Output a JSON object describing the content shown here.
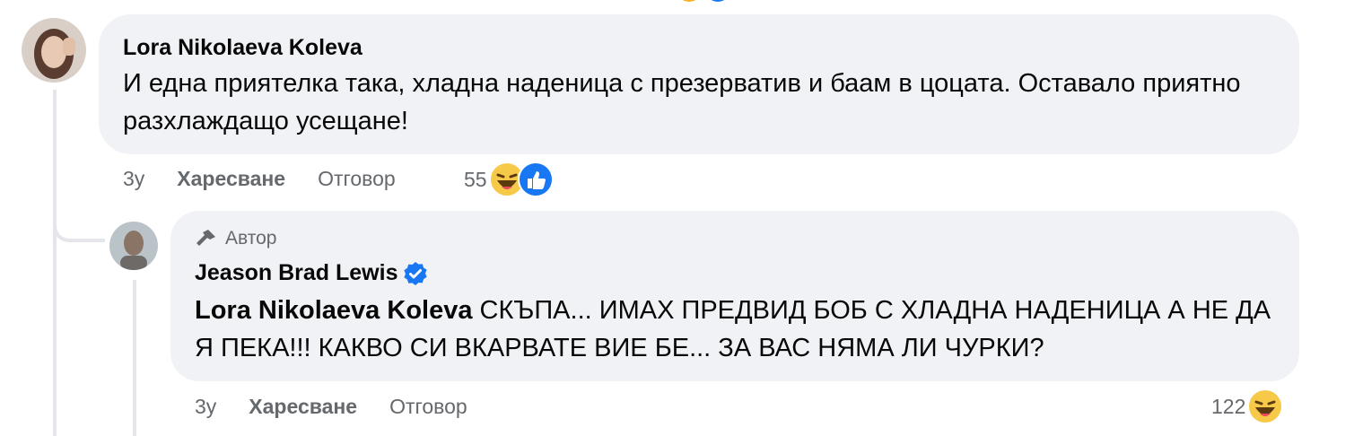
{
  "top_comment": {
    "author": "Lora Nikolaeva Koleva",
    "text": "И една приятелка така, хладна наденица с презерватив и баам в цоцата. Оставало приятно разхлаждащо усещане!",
    "time": "3у",
    "like_label": "Харесване",
    "reply_label": "Отговор",
    "reaction_count": "55",
    "reactions": [
      "haha-icon",
      "like-icon"
    ]
  },
  "reply": {
    "badge_label": "Автор",
    "author": "Jeason Brad Lewis",
    "verified": true,
    "mention": "Lora Nikolaeva Koleva",
    "text": " СКЪПА... ИМАХ ПРЕДВИД БОБ С ХЛАДНА НАДЕНИЦА А НЕ ДА Я ПЕКА!!! КАКВО СИ ВКАРВАТЕ ВИЕ БЕ... ЗА ВАС НЯМА ЛИ ЧУРКИ?",
    "time": "3у",
    "like_label": "Харесване",
    "reply_label": "Отговор",
    "reaction_count": "122",
    "reactions": [
      "haha-icon"
    ]
  },
  "colors": {
    "bubble": "#f0f2f5",
    "meta_text": "#65686c",
    "like_blue": "#1877f2",
    "verified_blue": "#1877f2"
  }
}
